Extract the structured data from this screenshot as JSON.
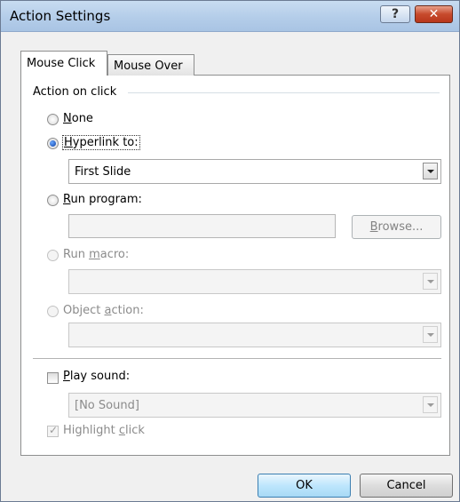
{
  "window": {
    "title": "Action Settings",
    "help_glyph": "?",
    "close_glyph": "✕"
  },
  "tabs": [
    {
      "label": "Mouse Click",
      "active": true
    },
    {
      "label": "Mouse Over",
      "active": false
    }
  ],
  "action_group": {
    "label": "Action on click",
    "none": {
      "label_prefix": "",
      "accel": "N",
      "label_rest": "one"
    },
    "hyperlink": {
      "accel": "H",
      "label_rest": "yperlink to:",
      "value": "First Slide"
    },
    "run_program": {
      "accel": "R",
      "label_rest": "un program:",
      "value": "",
      "browse_prefix": "",
      "browse_accel": "B",
      "browse_rest": "rowse..."
    },
    "run_macro": {
      "label_prefix": "Run ",
      "accel": "m",
      "label_rest": "acro:",
      "value": ""
    },
    "object_action": {
      "label_prefix": "Object ",
      "accel": "a",
      "label_rest": "ction:",
      "value": ""
    }
  },
  "sound": {
    "play_accel": "P",
    "play_rest": "lay sound:",
    "value": "[No Sound]",
    "highlight_prefix": "Highlight ",
    "highlight_accel": "c",
    "highlight_rest": "lick"
  },
  "buttons": {
    "ok": "OK",
    "cancel": "Cancel"
  },
  "icons": [
    "help-icon",
    "close-icon",
    "dropdown-arrow-icon",
    "checkmark-icon"
  ]
}
